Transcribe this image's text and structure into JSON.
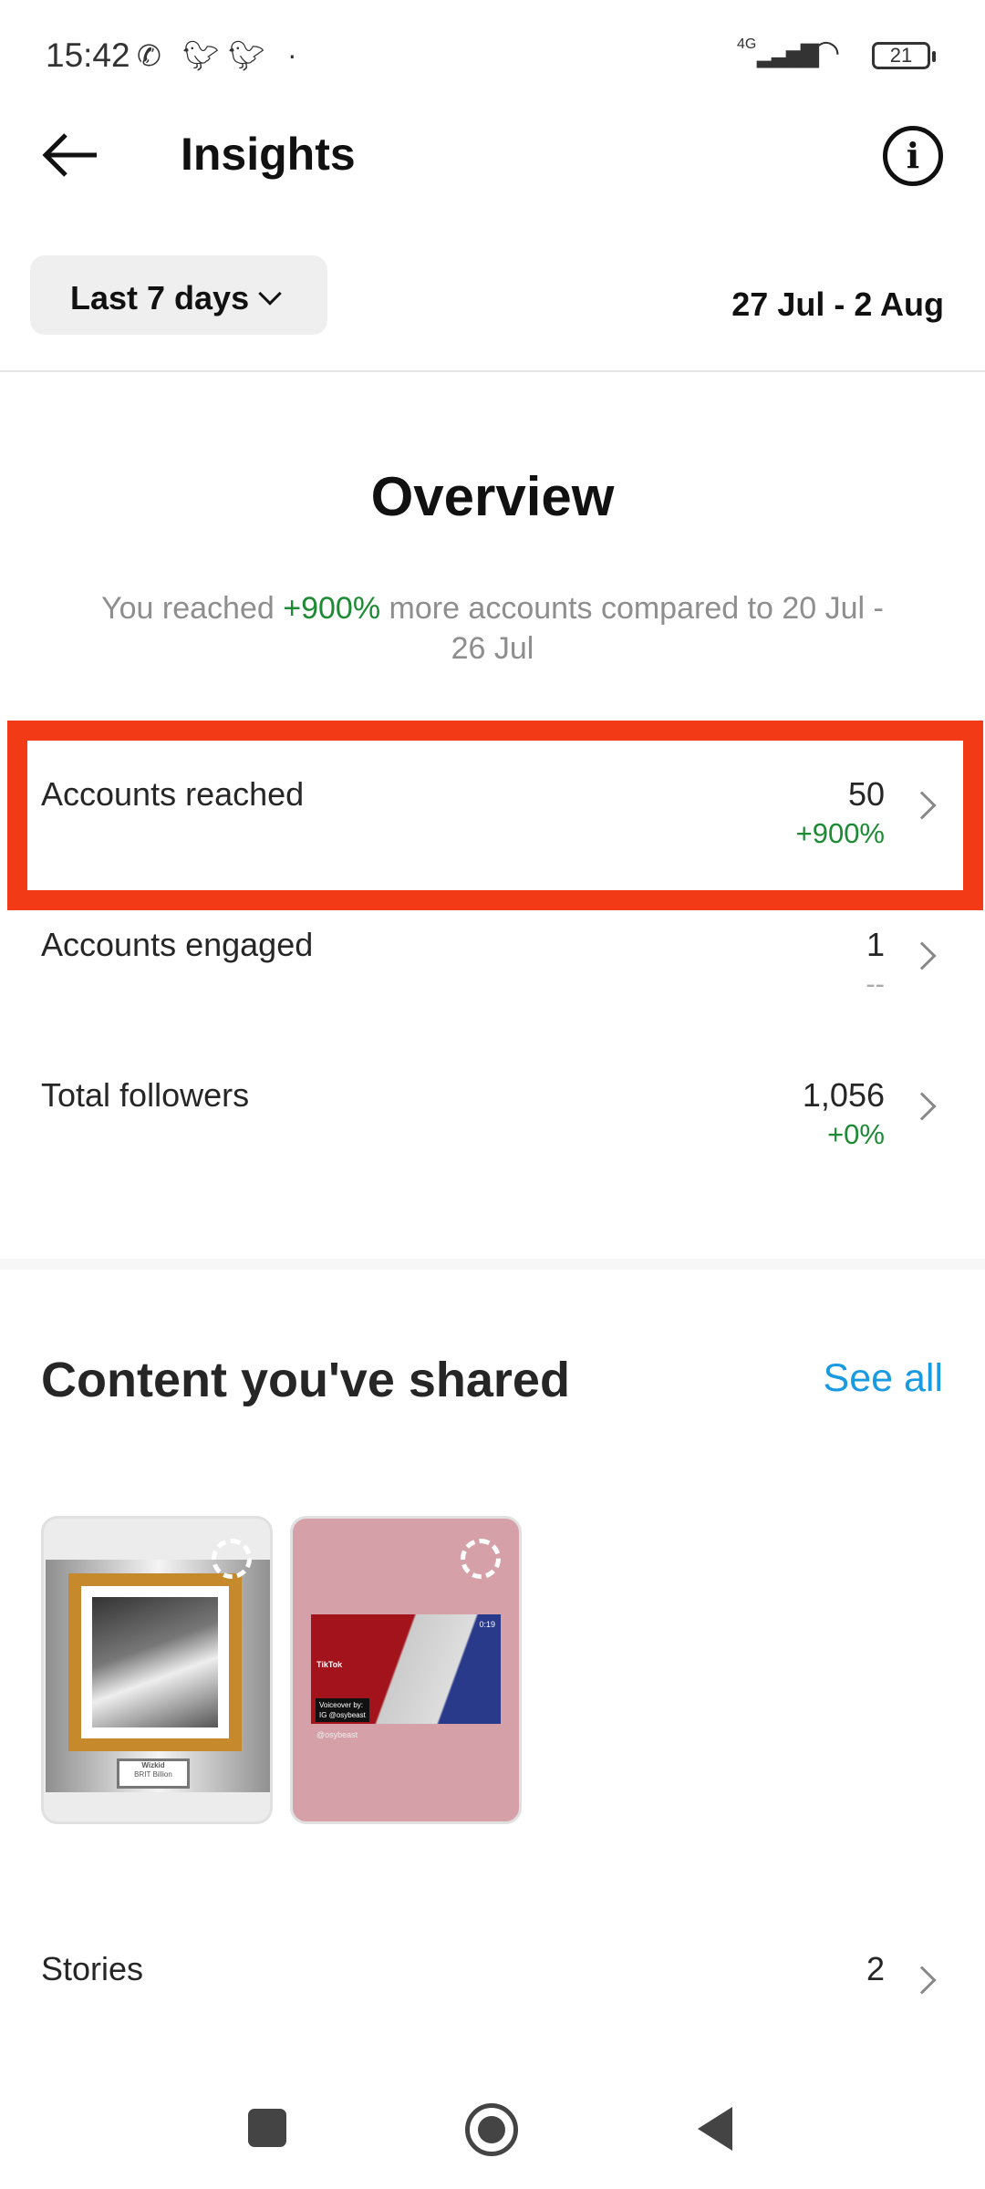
{
  "status_bar": {
    "time": "15:42",
    "network": "4G",
    "battery": "21",
    "icons": [
      "whatsapp-icon",
      "twitter-icon",
      "twitter-icon",
      "dot-icon",
      "signal-icon",
      "wifi-icon",
      "battery-icon"
    ]
  },
  "header": {
    "title": "Insights"
  },
  "filter": {
    "range_label": "Last 7 days",
    "dates": "27 Jul - 2 Aug"
  },
  "overview": {
    "title": "Overview",
    "summary_pre": "You reached ",
    "summary_delta": "+900%",
    "summary_post": " more accounts compared to 20 Jul - 26 Jul",
    "rows": [
      {
        "label": "Accounts reached",
        "value": "50",
        "delta": "+900%"
      },
      {
        "label": "Accounts engaged",
        "value": "1",
        "delta": "--"
      },
      {
        "label": "Total followers",
        "value": "1,056",
        "delta": "+0%"
      }
    ]
  },
  "content": {
    "title": "Content you've shared",
    "see_all": "See all",
    "thumbs": [
      {
        "plaque_name": "Wizkid",
        "plaque_sub": "BRIT Billion"
      },
      {
        "duration": "0:19",
        "brand": "TikTok",
        "voiceover": "Voiceover by:",
        "voiceover_handle": "IG @osybeast",
        "handle": "@osybeast"
      }
    ],
    "stories": {
      "label": "Stories",
      "value": "2"
    }
  },
  "colors": {
    "accent": "#1a9ae0",
    "positive": "#1d8a34",
    "highlight": "#f23a16"
  }
}
